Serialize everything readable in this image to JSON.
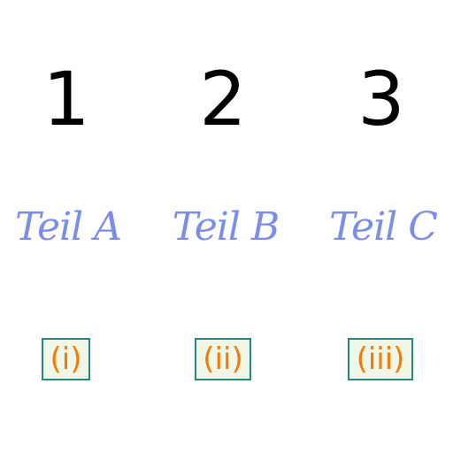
{
  "numerals": [
    "1",
    "2",
    "3"
  ],
  "parts": [
    "Teil A",
    "Teil B",
    "Teil C"
  ],
  "roman_labels": [
    "(i)",
    "(ii)",
    "(iii)"
  ],
  "colors": {
    "numeral_text": "#000000",
    "part_text": "#7b8de6",
    "roman_text": "#f07a0a",
    "roman_border": "#1f8a80",
    "roman_background": "#f0f7e6"
  }
}
